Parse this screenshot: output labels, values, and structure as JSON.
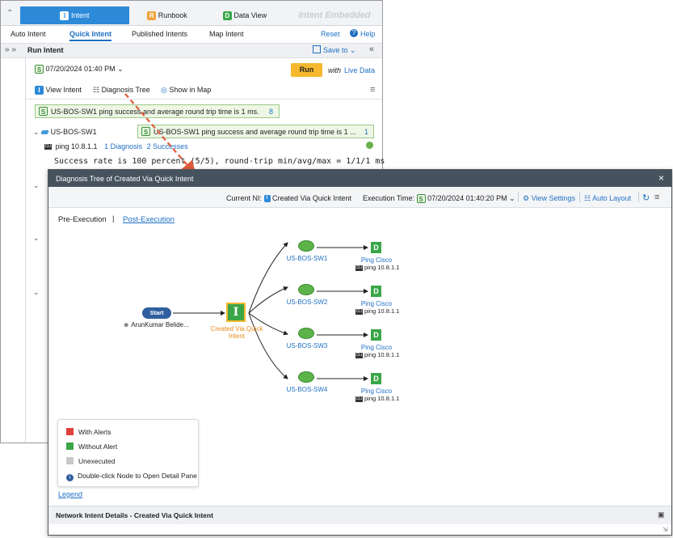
{
  "background_panel": {
    "tabs": [
      {
        "icon": "I",
        "label": "Intent"
      },
      {
        "icon": "R",
        "label": "Runbook"
      },
      {
        "icon": "D",
        "label": "Data View"
      },
      {
        "label": "Intent Embedded"
      }
    ],
    "subtabs": [
      "Auto Intent",
      "Quick Intent",
      "Published Intents",
      "Map Intent"
    ],
    "reset": "Reset",
    "help": "Help",
    "run_intent": "Run Intent",
    "save_to": "Save to",
    "time": "07/20/2024 01:40 PM",
    "run_button": "Run",
    "with_text": "with",
    "live_data": "Live Data",
    "toolbar": {
      "view_intent": "View Intent",
      "diagnosis_tree": "Diagnosis Tree",
      "show_in_map": "Show in Map"
    },
    "summary_text": "US-BOS-SW1 ping success and average round trip time is 1 ms.",
    "summary_count": "8",
    "device": "US-BOS-SW1",
    "device_summary": "US-BOS-SW1 ping success and average round trip time is 1 ...",
    "device_count": "1",
    "ping_cmd": "ping 10.8.1.1",
    "diagnosis": "1 Diagnosis",
    "successes": "2 Successes",
    "output_line": "Success rate is 100 percent (5/5), round-trip min/avg/max = 1/1/1 ms"
  },
  "dialog": {
    "title": "Diagnosis Tree of Created Via Quick Intent",
    "current_ni_label": "Current NI:",
    "current_ni": "Created Via Quick Intent",
    "execution_time_label": "Execution Time:",
    "execution_time": "07/20/2024 01:40:20 PM",
    "view_settings": "View Settings",
    "auto_layout": "Auto Layout",
    "pre_execution": "Pre-Execution",
    "post_execution": "Post-Execution",
    "start_label": "Start",
    "user": "ArunKumar Belide...",
    "intent_node": "I",
    "intent_label": "Created Via Quick Intent",
    "devices": [
      "US-BOS-SW1",
      "US-BOS-SW2",
      "US-BOS-SW3",
      "US-BOS-SW4"
    ],
    "d_node": "D",
    "ping_cisco": "Ping Cisco",
    "ping_cmd": "ping 10.8.1.1",
    "legend": {
      "with_alerts": "With Alerts",
      "without_alert": "Without Alert",
      "unexecuted": "Unexecuted",
      "hint": "Double-click Node to Open Detail Pane",
      "link": "Legend"
    },
    "footer": "Network Intent Details - Created Via Quick Intent"
  },
  "colors": {
    "alert": "#e0403a",
    "ok": "#3aa648",
    "unexecuted": "#c8c8c8",
    "link": "#1f6fc4",
    "run": "#f5b82e",
    "arrow": "#e05a3a"
  }
}
